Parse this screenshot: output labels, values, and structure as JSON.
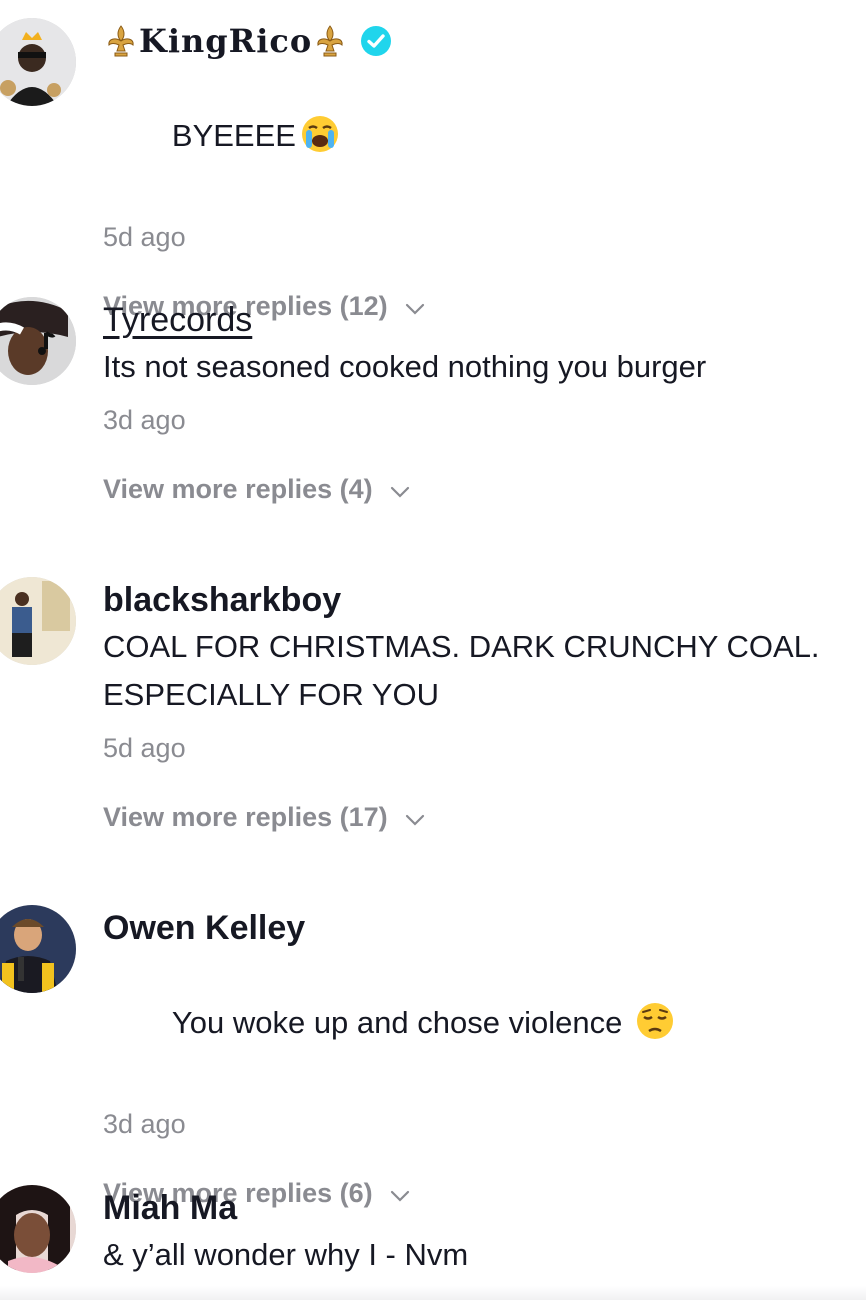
{
  "comments": [
    {
      "username": "KingRico",
      "text": "BYEEEE",
      "emoji": "loudly-crying-face",
      "time": "5d ago",
      "replies": "View more replies (12)",
      "verified": true,
      "verified_color": "#20d5ec"
    },
    {
      "username": "Tyrecords",
      "text": "Its not seasoned cooked nothing you burger",
      "time": "3d ago",
      "replies": "View more replies (4)"
    },
    {
      "username": "blacksharkboy",
      "text": "COAL FOR CHRISTMAS. DARK CRUNCHY COAL. ESPECIALLY FOR YOU",
      "time": "5d ago",
      "replies": "View more replies (17)"
    },
    {
      "username": "Owen Kelley",
      "text": "You woke up and chose violence",
      "emoji": "pensive-face",
      "time": "3d ago",
      "replies": "View more replies (6)"
    },
    {
      "username": "Miah Ma",
      "text": "& y’all wonder why I - Nvm"
    }
  ],
  "colors": {
    "text": "#161823",
    "secondary": "#8a8b91",
    "verified": "#20d5ec"
  }
}
